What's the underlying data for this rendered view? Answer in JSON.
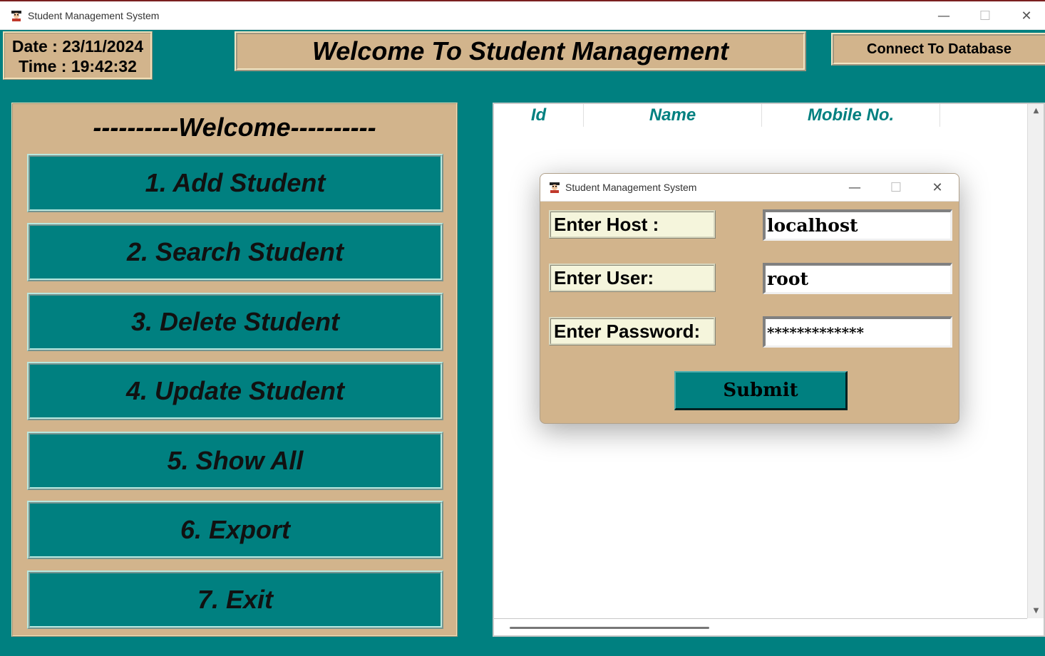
{
  "main_window": {
    "title": "Student Management System",
    "icon": "student-avatar-icon",
    "controls": {
      "minimize": "—",
      "maximize": "☐",
      "close": "✕"
    }
  },
  "header": {
    "date": "Date : 23/11/2024",
    "time": "Time : 19:42:32",
    "welcome": "Welcome To Student Management",
    "connect_button": "Connect To Database"
  },
  "menu": {
    "heading": "----------Welcome----------",
    "buttons": [
      "1. Add Student",
      "2. Search Student",
      "3. Delete Student",
      "4. Update Student",
      "5. Show All",
      "6. Export",
      "7. Exit"
    ]
  },
  "table": {
    "columns": [
      "Id",
      "Name",
      "Mobile No."
    ]
  },
  "dialog": {
    "title": "Student Management System",
    "controls": {
      "minimize": "—",
      "maximize": "☐",
      "close": "✕"
    },
    "host_label": "Enter Host :",
    "host_value": "localhost",
    "user_label": "Enter User:",
    "user_value": "root",
    "password_label": "Enter Password:",
    "password_value": "*************",
    "submit": "Submit"
  },
  "colors": {
    "teal": "#008080",
    "tan": "#d2b48c",
    "beige": "#f5f5dc"
  }
}
